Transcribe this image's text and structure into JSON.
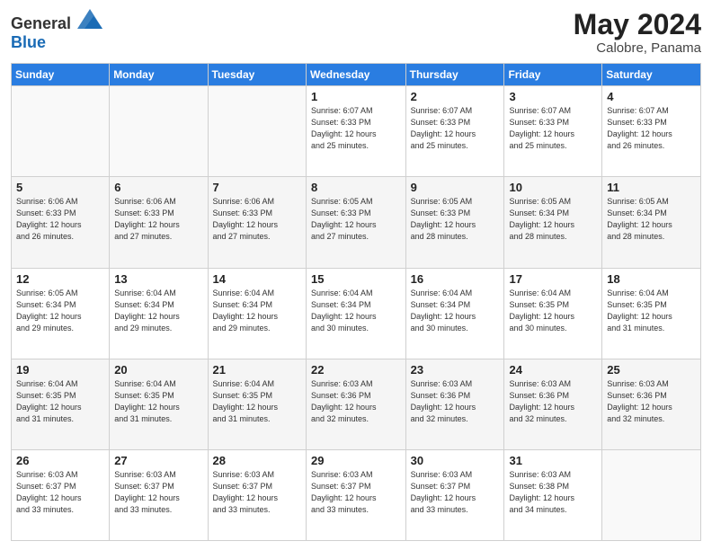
{
  "logo": {
    "general": "General",
    "blue": "Blue"
  },
  "header": {
    "month_year": "May 2024",
    "location": "Calobre, Panama"
  },
  "days_of_week": [
    "Sunday",
    "Monday",
    "Tuesday",
    "Wednesday",
    "Thursday",
    "Friday",
    "Saturday"
  ],
  "weeks": [
    [
      {
        "num": "",
        "info": ""
      },
      {
        "num": "",
        "info": ""
      },
      {
        "num": "",
        "info": ""
      },
      {
        "num": "1",
        "info": "Sunrise: 6:07 AM\nSunset: 6:33 PM\nDaylight: 12 hours\nand 25 minutes."
      },
      {
        "num": "2",
        "info": "Sunrise: 6:07 AM\nSunset: 6:33 PM\nDaylight: 12 hours\nand 25 minutes."
      },
      {
        "num": "3",
        "info": "Sunrise: 6:07 AM\nSunset: 6:33 PM\nDaylight: 12 hours\nand 25 minutes."
      },
      {
        "num": "4",
        "info": "Sunrise: 6:07 AM\nSunset: 6:33 PM\nDaylight: 12 hours\nand 26 minutes."
      }
    ],
    [
      {
        "num": "5",
        "info": "Sunrise: 6:06 AM\nSunset: 6:33 PM\nDaylight: 12 hours\nand 26 minutes."
      },
      {
        "num": "6",
        "info": "Sunrise: 6:06 AM\nSunset: 6:33 PM\nDaylight: 12 hours\nand 27 minutes."
      },
      {
        "num": "7",
        "info": "Sunrise: 6:06 AM\nSunset: 6:33 PM\nDaylight: 12 hours\nand 27 minutes."
      },
      {
        "num": "8",
        "info": "Sunrise: 6:05 AM\nSunset: 6:33 PM\nDaylight: 12 hours\nand 27 minutes."
      },
      {
        "num": "9",
        "info": "Sunrise: 6:05 AM\nSunset: 6:33 PM\nDaylight: 12 hours\nand 28 minutes."
      },
      {
        "num": "10",
        "info": "Sunrise: 6:05 AM\nSunset: 6:34 PM\nDaylight: 12 hours\nand 28 minutes."
      },
      {
        "num": "11",
        "info": "Sunrise: 6:05 AM\nSunset: 6:34 PM\nDaylight: 12 hours\nand 28 minutes."
      }
    ],
    [
      {
        "num": "12",
        "info": "Sunrise: 6:05 AM\nSunset: 6:34 PM\nDaylight: 12 hours\nand 29 minutes."
      },
      {
        "num": "13",
        "info": "Sunrise: 6:04 AM\nSunset: 6:34 PM\nDaylight: 12 hours\nand 29 minutes."
      },
      {
        "num": "14",
        "info": "Sunrise: 6:04 AM\nSunset: 6:34 PM\nDaylight: 12 hours\nand 29 minutes."
      },
      {
        "num": "15",
        "info": "Sunrise: 6:04 AM\nSunset: 6:34 PM\nDaylight: 12 hours\nand 30 minutes."
      },
      {
        "num": "16",
        "info": "Sunrise: 6:04 AM\nSunset: 6:34 PM\nDaylight: 12 hours\nand 30 minutes."
      },
      {
        "num": "17",
        "info": "Sunrise: 6:04 AM\nSunset: 6:35 PM\nDaylight: 12 hours\nand 30 minutes."
      },
      {
        "num": "18",
        "info": "Sunrise: 6:04 AM\nSunset: 6:35 PM\nDaylight: 12 hours\nand 31 minutes."
      }
    ],
    [
      {
        "num": "19",
        "info": "Sunrise: 6:04 AM\nSunset: 6:35 PM\nDaylight: 12 hours\nand 31 minutes."
      },
      {
        "num": "20",
        "info": "Sunrise: 6:04 AM\nSunset: 6:35 PM\nDaylight: 12 hours\nand 31 minutes."
      },
      {
        "num": "21",
        "info": "Sunrise: 6:04 AM\nSunset: 6:35 PM\nDaylight: 12 hours\nand 31 minutes."
      },
      {
        "num": "22",
        "info": "Sunrise: 6:03 AM\nSunset: 6:36 PM\nDaylight: 12 hours\nand 32 minutes."
      },
      {
        "num": "23",
        "info": "Sunrise: 6:03 AM\nSunset: 6:36 PM\nDaylight: 12 hours\nand 32 minutes."
      },
      {
        "num": "24",
        "info": "Sunrise: 6:03 AM\nSunset: 6:36 PM\nDaylight: 12 hours\nand 32 minutes."
      },
      {
        "num": "25",
        "info": "Sunrise: 6:03 AM\nSunset: 6:36 PM\nDaylight: 12 hours\nand 32 minutes."
      }
    ],
    [
      {
        "num": "26",
        "info": "Sunrise: 6:03 AM\nSunset: 6:37 PM\nDaylight: 12 hours\nand 33 minutes."
      },
      {
        "num": "27",
        "info": "Sunrise: 6:03 AM\nSunset: 6:37 PM\nDaylight: 12 hours\nand 33 minutes."
      },
      {
        "num": "28",
        "info": "Sunrise: 6:03 AM\nSunset: 6:37 PM\nDaylight: 12 hours\nand 33 minutes."
      },
      {
        "num": "29",
        "info": "Sunrise: 6:03 AM\nSunset: 6:37 PM\nDaylight: 12 hours\nand 33 minutes."
      },
      {
        "num": "30",
        "info": "Sunrise: 6:03 AM\nSunset: 6:37 PM\nDaylight: 12 hours\nand 33 minutes."
      },
      {
        "num": "31",
        "info": "Sunrise: 6:03 AM\nSunset: 6:38 PM\nDaylight: 12 hours\nand 34 minutes."
      },
      {
        "num": "",
        "info": ""
      }
    ]
  ]
}
